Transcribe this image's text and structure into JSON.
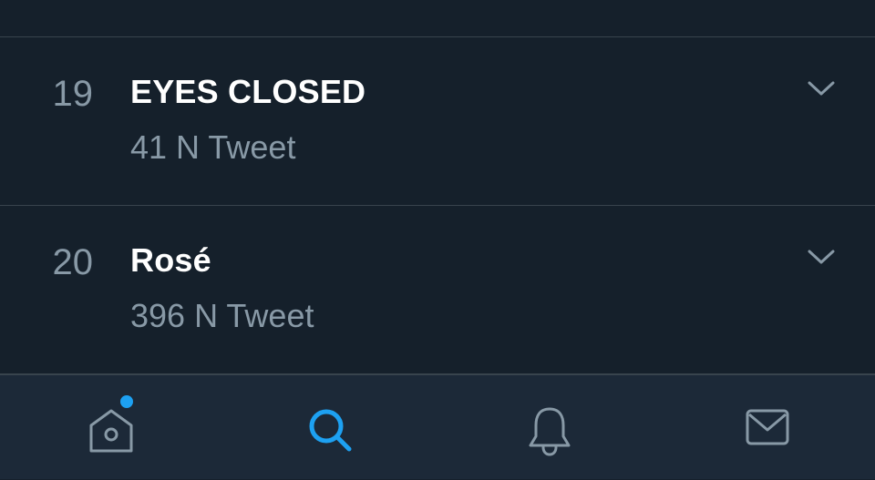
{
  "trends": [
    {
      "rank": "19",
      "title": "EYES CLOSED",
      "meta": "41 N Tweet"
    },
    {
      "rank": "20",
      "title": "Rosé",
      "meta": "396 N Tweet"
    }
  ],
  "tabbar": {
    "tabs": [
      {
        "name": "home",
        "icon": "home-icon",
        "active": false,
        "has_notification_dot": true
      },
      {
        "name": "search",
        "icon": "search-icon",
        "active": true
      },
      {
        "name": "notifications",
        "icon": "bell-icon",
        "active": false
      },
      {
        "name": "messages",
        "icon": "mail-icon",
        "active": false
      }
    ]
  },
  "colors": {
    "background": "#15202b",
    "tabbar_background": "#1c2938",
    "divider": "#38444d",
    "text_primary": "#ffffff",
    "text_secondary": "#8899a6",
    "accent": "#1da1f2"
  }
}
